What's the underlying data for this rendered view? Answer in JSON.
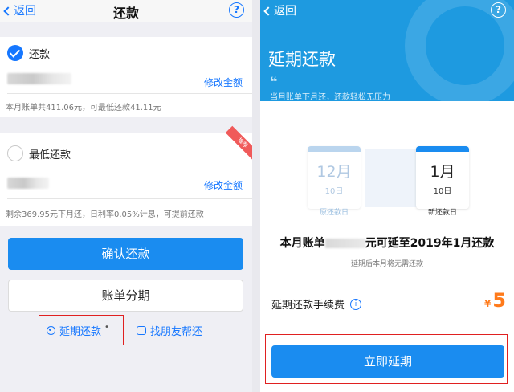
{
  "left": {
    "nav": {
      "back_label": "返回",
      "title": "还款",
      "help": "?"
    },
    "full_option": {
      "label": "还款",
      "modify": "修改金额",
      "note": "本月账单共411.06元，可最低还款41.11元"
    },
    "min_option": {
      "label": "最低还款",
      "badge": "推荐",
      "modify": "修改金额",
      "note": "剩余369.95元下月还，日利率0.05%计息，可提前还款"
    },
    "confirm_button": "确认还款",
    "installment_button": "账单分期",
    "extend_link": "延期还款",
    "extend_dot": "•",
    "friend_link": "找朋友帮还"
  },
  "right": {
    "nav": {
      "back_label": "返回",
      "help": "?"
    },
    "hero": {
      "title": "延期还款",
      "quote": "❝",
      "subtitle": "当月账单下月还，还款轻松无压力"
    },
    "calendar": {
      "old": {
        "month": "12月",
        "day": "10日",
        "caption": "原还款日"
      },
      "new": {
        "month": "1月",
        "day": "10日",
        "caption": "新还款日"
      }
    },
    "statement": {
      "prefix": "本月账单",
      "suffix": "元可延至2019年1月还款"
    },
    "statement_sub": "延期后本月将无需还款",
    "fee": {
      "label": "延期还款手续费",
      "info": "i",
      "currency": "¥",
      "amount": "5"
    },
    "extend_button": "立即延期"
  }
}
